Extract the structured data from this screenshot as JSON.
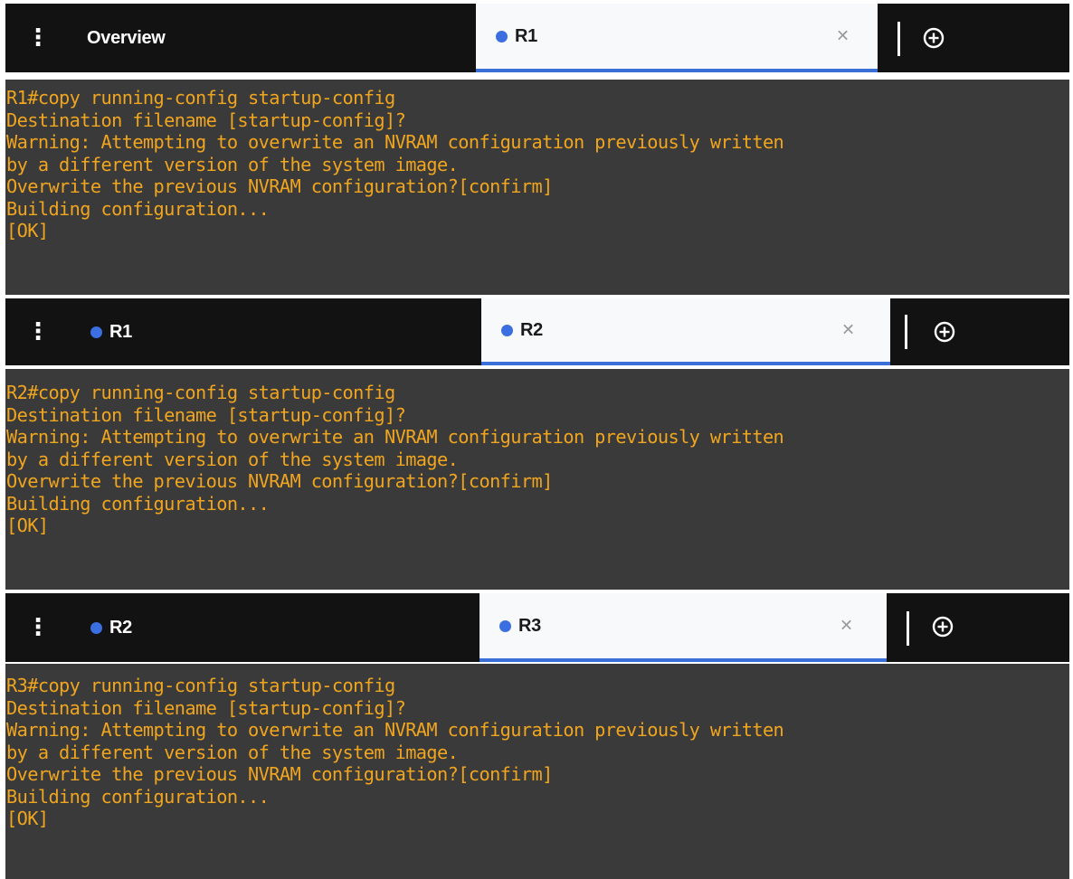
{
  "panels": [
    {
      "tabs": [
        {
          "label": "Overview",
          "dot": false,
          "active": false
        },
        {
          "label": "R1",
          "dot": true,
          "active": true
        }
      ],
      "terminal_lines": [
        "R1#copy running-config startup-config",
        "Destination filename [startup-config]?",
        "Warning: Attempting to overwrite an NVRAM configuration previously written",
        "by a different version of the system image.",
        "Overwrite the previous NVRAM configuration?[confirm]",
        "Building configuration...",
        "[OK]"
      ]
    },
    {
      "tabs": [
        {
          "label": "R1",
          "dot": true,
          "active": false
        },
        {
          "label": "R2",
          "dot": true,
          "active": true
        }
      ],
      "terminal_lines": [
        "R2#copy running-config startup-config",
        "Destination filename [startup-config]?",
        "Warning: Attempting to overwrite an NVRAM configuration previously written",
        "by a different version of the system image.",
        "Overwrite the previous NVRAM configuration?[confirm]",
        "Building configuration...",
        "[OK]"
      ]
    },
    {
      "tabs": [
        {
          "label": "R2",
          "dot": true,
          "active": false
        },
        {
          "label": "R3",
          "dot": true,
          "active": true
        }
      ],
      "terminal_lines": [
        "R3#copy running-config startup-config",
        "Destination filename [startup-config]?",
        "Warning: Attempting to overwrite an NVRAM configuration previously written",
        "by a different version of the system image.",
        "Overwrite the previous NVRAM configuration?[confirm]",
        "Building configuration...",
        "[OK]"
      ]
    }
  ],
  "icons": {
    "menu": "vertical-dots-icon",
    "close": "close-icon",
    "new_tab": "plus-circle-icon",
    "status_dot": "status-dot-icon"
  },
  "colors": {
    "tabbar_bg": "#121212",
    "active_tab_bg": "#f8f9fa",
    "active_tab_underline": "#3b6fd8",
    "status_dot": "#3b6ee0",
    "terminal_bg": "#3a3a3a",
    "terminal_text": "#f0a51f"
  }
}
